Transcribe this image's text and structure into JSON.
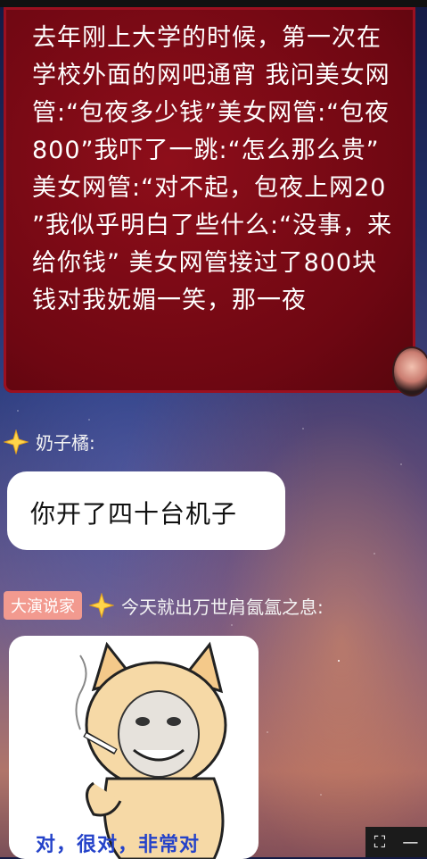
{
  "messages": {
    "red_bubble_text": "去年刚上大学的时候，第一次在学校外面的网吧通宵 我问美女网管:“包夜多少钱”美女网管:“包夜800”我吓了一跳:“怎么那么贵” 美女网管:“对不起，包夜上网20 ”我似乎明白了些什么:“没事，来给你钱” 美女网管接过了800块钱对我妩媚一笑，那一夜",
    "sender1_name": "奶子橘:",
    "white_bubble_text": "你开了四十台机子",
    "sender2_tag": "大演说家",
    "sender2_name": "今天就出万世肩氤氲之息:",
    "sticker_caption": "对，很对，非常对"
  },
  "icons": {
    "sparkle": "sparkle-icon",
    "fullscreen": "fullscreen-icon",
    "minimize": "minimize-icon"
  },
  "colors": {
    "red_bubble": "#6e0712",
    "tag_bg": "#f29a8f",
    "caption": "#2442c9"
  }
}
